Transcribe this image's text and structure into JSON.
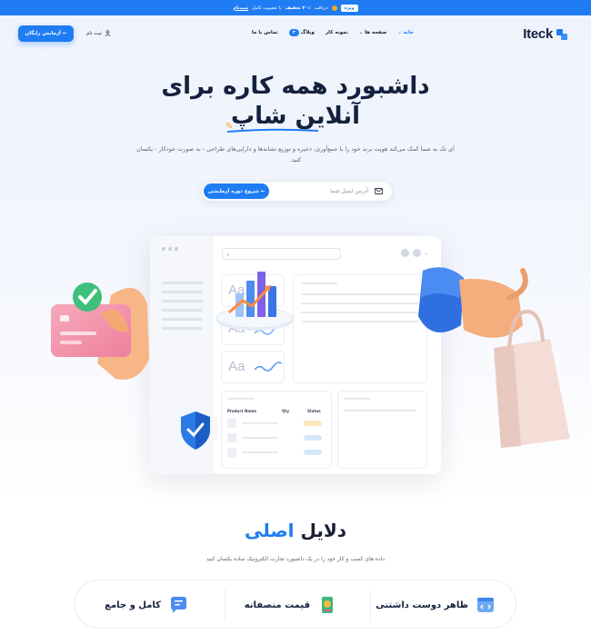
{
  "topbar": {
    "badge": "ویژه",
    "text_before": "دریافت",
    "highlight": "۳۰٪ تخفیف",
    "text_after": "با عضویت کامل",
    "link": "ثبت‌نام"
  },
  "nav": {
    "logo": "Iteck",
    "menu": [
      {
        "label": "خانه",
        "active": true,
        "dropdown": true
      },
      {
        "label": "صفحه ها",
        "active": false,
        "dropdown": true
      },
      {
        "label": "نمونه کار",
        "active": false,
        "dropdown": false
      },
      {
        "label": "وبلاگ",
        "active": false,
        "dropdown": false,
        "badge": "۳"
      },
      {
        "label": "تماس با ما",
        "active": false,
        "dropdown": false
      }
    ],
    "register": "ثبت نام",
    "cta": "آزمایش رایگان"
  },
  "hero": {
    "title_line1": "داشبورد همه کاره برای",
    "title_line2": "آنلاین شاپ",
    "subtitle": "آی تک به شما کمک می‌کند هویت برند خود را با جمع‌آوری، ذخیره و توزیع نشانه‌ها و دارایی‌های طراحی - به صورت خودکار - یکسان کنید.",
    "email_placeholder": "آدرس ایمیل شما",
    "email_button": "شروع دوره آزمایشی ←"
  },
  "dashboard": {
    "aa_label": "Aa",
    "table_headers": [
      "Product Name",
      "Qty",
      "Status"
    ]
  },
  "reasons": {
    "title_main": "دلایل",
    "title_accent": "اصلی",
    "subtitle": "داده های کسب و کار خود را در یک داشبورد تجارت الکترونیک ساده یکسان کنید",
    "features": [
      {
        "label": "ظاهر دوست داشتنی",
        "icon": "code-window-icon"
      },
      {
        "label": "قیمت منصفانه",
        "icon": "price-tag-icon"
      },
      {
        "label": "کامل و جامع",
        "icon": "chat-bubble-icon"
      }
    ]
  },
  "colors": {
    "accent": "#1f7cf2",
    "heading": "#14213d"
  }
}
